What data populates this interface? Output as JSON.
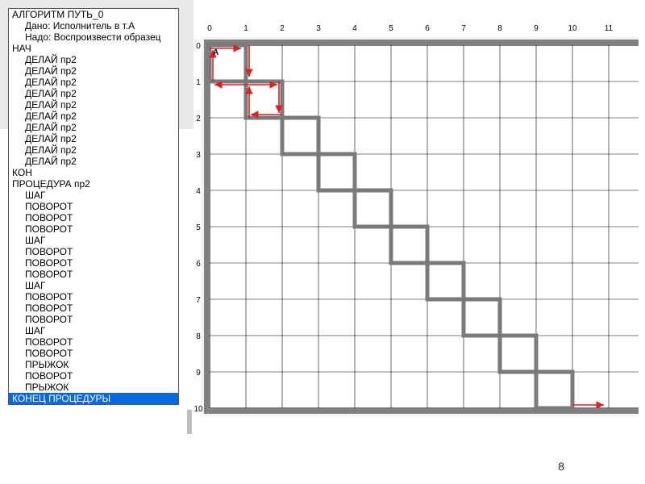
{
  "code": {
    "lines": [
      {
        "indent": 0,
        "text": "АЛГОРИТМ ПУТЬ_0"
      },
      {
        "indent": 1,
        "text": "Дано: Исполнитель в т.А"
      },
      {
        "indent": 1,
        "text": "Надо: Воспроизвести образец"
      },
      {
        "indent": 0,
        "text": "НАЧ"
      },
      {
        "indent": 1,
        "text": "ДЕЛАЙ пр2"
      },
      {
        "indent": 1,
        "text": "ДЕЛАЙ пр2"
      },
      {
        "indent": 1,
        "text": "ДЕЛАЙ пр2"
      },
      {
        "indent": 1,
        "text": "ДЕЛАЙ пр2"
      },
      {
        "indent": 1,
        "text": "ДЕЛАЙ пр2"
      },
      {
        "indent": 1,
        "text": "ДЕЛАЙ пр2"
      },
      {
        "indent": 1,
        "text": "ДЕЛАЙ пр2"
      },
      {
        "indent": 1,
        "text": "ДЕЛАЙ пр2"
      },
      {
        "indent": 1,
        "text": "ДЕЛАЙ пр2"
      },
      {
        "indent": 1,
        "text": "ДЕЛАЙ пр2"
      },
      {
        "indent": 0,
        "text": "КОН"
      },
      {
        "indent": 0,
        "text": "ПРОЦЕДУРА пр2"
      },
      {
        "indent": 1,
        "text": "ШАГ"
      },
      {
        "indent": 1,
        "text": "ПОВОРОТ"
      },
      {
        "indent": 1,
        "text": "ПОВОРОТ"
      },
      {
        "indent": 1,
        "text": "ПОВОРОТ"
      },
      {
        "indent": 1,
        "text": "ШАГ"
      },
      {
        "indent": 1,
        "text": "ПОВОРОТ"
      },
      {
        "indent": 1,
        "text": "ПОВОРОТ"
      },
      {
        "indent": 1,
        "text": "ПОВОРОТ"
      },
      {
        "indent": 1,
        "text": "ШАГ"
      },
      {
        "indent": 1,
        "text": "ПОВОРОТ"
      },
      {
        "indent": 1,
        "text": "ПОВОРОТ"
      },
      {
        "indent": 1,
        "text": "ПОВОРОТ"
      },
      {
        "indent": 1,
        "text": "ШАГ"
      },
      {
        "indent": 1,
        "text": "ПОВОРОТ"
      },
      {
        "indent": 1,
        "text": "ПОВОРОТ"
      },
      {
        "indent": 1,
        "text": "ПРЫЖОК"
      },
      {
        "indent": 1,
        "text": "ПОВОРОТ"
      },
      {
        "indent": 1,
        "text": "ПРЫЖОК"
      },
      {
        "indent": 0,
        "text": "КОНЕЦ ПРОЦЕДУРЫ",
        "selected": true
      }
    ]
  },
  "grid": {
    "cols": 12,
    "rows": 10,
    "col_labels": [
      "0",
      "1",
      "2",
      "3",
      "4",
      "5",
      "6",
      "7",
      "8",
      "9",
      "10",
      "11"
    ],
    "row_labels": [
      "0",
      "1",
      "2",
      "3",
      "4",
      "5",
      "6",
      "7",
      "8",
      "9",
      "10"
    ],
    "start_label": "A",
    "cell": 45
  },
  "path": {
    "description": "staircase of 1x1 squares from (0,0) to (10,10)",
    "segments_gray": [
      [
        0,
        0,
        1,
        0
      ],
      [
        1,
        0,
        1,
        1
      ],
      [
        0,
        0,
        0,
        1
      ],
      [
        0,
        1,
        1,
        1
      ],
      [
        1,
        1,
        2,
        1
      ],
      [
        2,
        1,
        2,
        2
      ],
      [
        1,
        1,
        1,
        2
      ],
      [
        1,
        2,
        2,
        2
      ],
      [
        2,
        2,
        3,
        2
      ],
      [
        3,
        2,
        3,
        3
      ],
      [
        2,
        2,
        2,
        3
      ],
      [
        2,
        3,
        3,
        3
      ],
      [
        3,
        3,
        4,
        3
      ],
      [
        4,
        3,
        4,
        4
      ],
      [
        3,
        3,
        3,
        4
      ],
      [
        3,
        4,
        4,
        4
      ],
      [
        4,
        4,
        5,
        4
      ],
      [
        5,
        4,
        5,
        5
      ],
      [
        4,
        4,
        4,
        5
      ],
      [
        4,
        5,
        5,
        5
      ],
      [
        5,
        5,
        6,
        5
      ],
      [
        6,
        5,
        6,
        6
      ],
      [
        5,
        5,
        5,
        6
      ],
      [
        5,
        6,
        6,
        6
      ],
      [
        6,
        6,
        7,
        6
      ],
      [
        7,
        6,
        7,
        7
      ],
      [
        6,
        6,
        6,
        7
      ],
      [
        6,
        7,
        7,
        7
      ],
      [
        7,
        7,
        8,
        7
      ],
      [
        8,
        7,
        8,
        8
      ],
      [
        7,
        7,
        7,
        8
      ],
      [
        7,
        8,
        8,
        8
      ],
      [
        8,
        8,
        9,
        8
      ],
      [
        9,
        8,
        9,
        9
      ],
      [
        8,
        8,
        8,
        9
      ],
      [
        8,
        9,
        9,
        9
      ],
      [
        9,
        9,
        10,
        9
      ],
      [
        10,
        9,
        10,
        10
      ],
      [
        9,
        9,
        9,
        10
      ],
      [
        9,
        10,
        10,
        10
      ]
    ],
    "arrows_red": [
      {
        "from": [
          0,
          0
        ],
        "to": [
          1,
          0
        ]
      },
      {
        "from": [
          1,
          0
        ],
        "to": [
          1,
          1
        ]
      },
      {
        "from": [
          1,
          1
        ],
        "to": [
          0,
          1
        ]
      },
      {
        "from": [
          0,
          1
        ],
        "to": [
          0,
          0
        ]
      },
      {
        "from": [
          1,
          1
        ],
        "to": [
          2,
          1
        ]
      },
      {
        "from": [
          2,
          1
        ],
        "to": [
          2,
          2
        ]
      },
      {
        "from": [
          2,
          2
        ],
        "to": [
          1,
          2
        ]
      },
      {
        "from": [
          1,
          2
        ],
        "to": [
          1,
          1
        ]
      },
      {
        "from": [
          10,
          10
        ],
        "to": [
          11,
          10
        ]
      }
    ]
  },
  "colors": {
    "grid_line": "#000",
    "frame": "#808080",
    "path_gray": "#7a7a7a",
    "arrow_red": "#e02020",
    "selection_bg": "#0a68e0"
  },
  "page_number": "8"
}
